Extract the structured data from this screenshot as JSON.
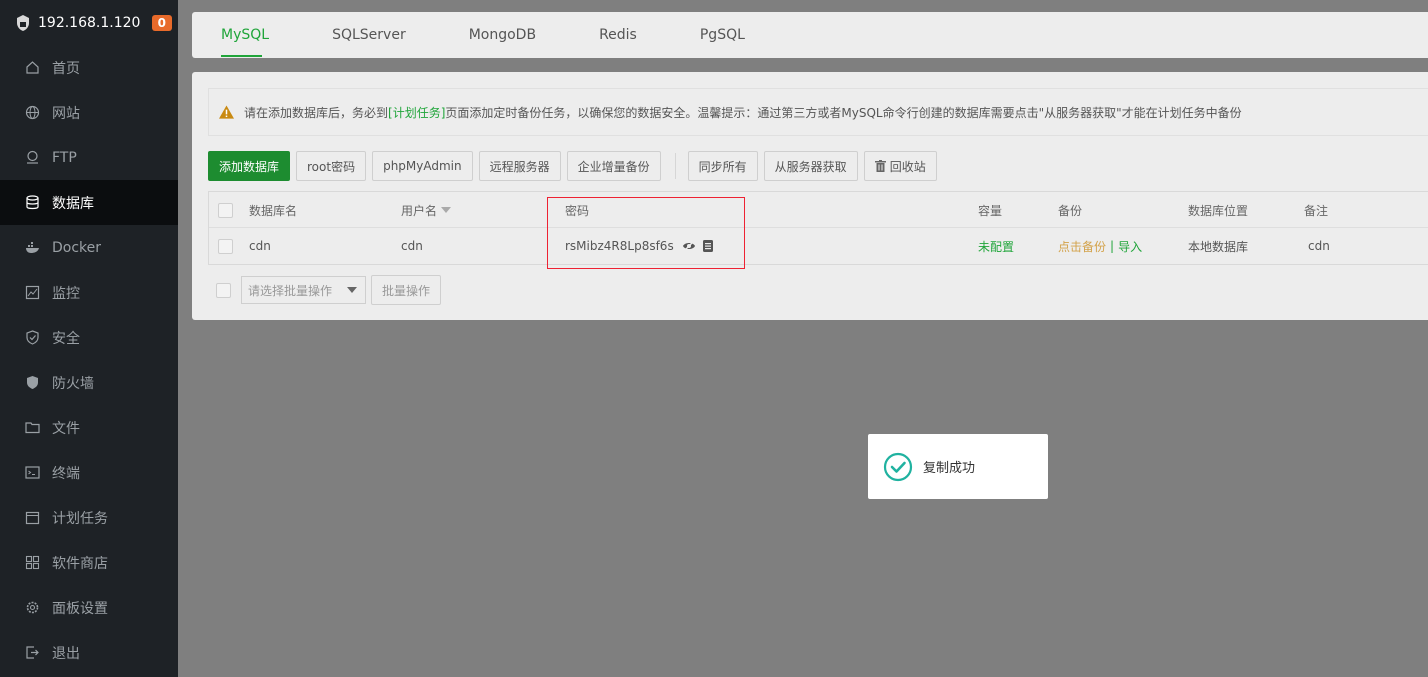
{
  "server": {
    "ip": "192.168.1.120",
    "badge": "0"
  },
  "sidebar": {
    "items": [
      {
        "label": "首页",
        "icon": "home-icon"
      },
      {
        "label": "网站",
        "icon": "globe-icon"
      },
      {
        "label": "FTP",
        "icon": "ftp-icon"
      },
      {
        "label": "数据库",
        "icon": "database-icon",
        "active": true
      },
      {
        "label": "Docker",
        "icon": "docker-icon"
      },
      {
        "label": "监控",
        "icon": "monitor-icon"
      },
      {
        "label": "安全",
        "icon": "shield-icon"
      },
      {
        "label": "防火墙",
        "icon": "firewall-icon"
      },
      {
        "label": "文件",
        "icon": "folder-icon"
      },
      {
        "label": "终端",
        "icon": "terminal-icon"
      },
      {
        "label": "计划任务",
        "icon": "calendar-icon"
      },
      {
        "label": "软件商店",
        "icon": "apps-icon"
      },
      {
        "label": "面板设置",
        "icon": "gear-icon"
      },
      {
        "label": "退出",
        "icon": "logout-icon"
      }
    ]
  },
  "tabs": [
    {
      "label": "MySQL",
      "active": true
    },
    {
      "label": "SQLServer"
    },
    {
      "label": "MongoDB"
    },
    {
      "label": "Redis"
    },
    {
      "label": "PgSQL"
    }
  ],
  "notice": {
    "pre": "请在添加数据库后，务必到",
    "link": "[计划任务]",
    "post": "页面添加定时备份任务，以确保您的数据安全。温馨提示：通过第三方或者MySQL命令行创建的数据库需要点击\"从服务器获取\"才能在计划任务中备份"
  },
  "toolbar": {
    "add": "添加数据库",
    "root": "root密码",
    "phpmyadmin": "phpMyAdmin",
    "remote": "远程服务器",
    "incremental": "企业增量备份",
    "sync": "同步所有",
    "fetch": "从服务器获取",
    "recycle": "回收站"
  },
  "table": {
    "headers": {
      "name": "数据库名",
      "user": "用户名",
      "password": "密码",
      "capacity": "容量",
      "backup": "备份",
      "location": "数据库位置",
      "note": "备注"
    },
    "rows": [
      {
        "name": "cdn",
        "user": "cdn",
        "password": "rsMibz4R8Lp8sf6s",
        "capacity": "未配置",
        "backup_click": "点击备份",
        "backup_sep": "|",
        "backup_import": "导入",
        "location": "本地数据库",
        "note": "cdn"
      }
    ]
  },
  "batch": {
    "placeholder": "请选择批量操作",
    "button": "批量操作"
  },
  "toast": {
    "message": "复制成功"
  },
  "colors": {
    "accent": "#20a53a",
    "highlight": "#e22233",
    "sidebar": "#1e2226"
  }
}
